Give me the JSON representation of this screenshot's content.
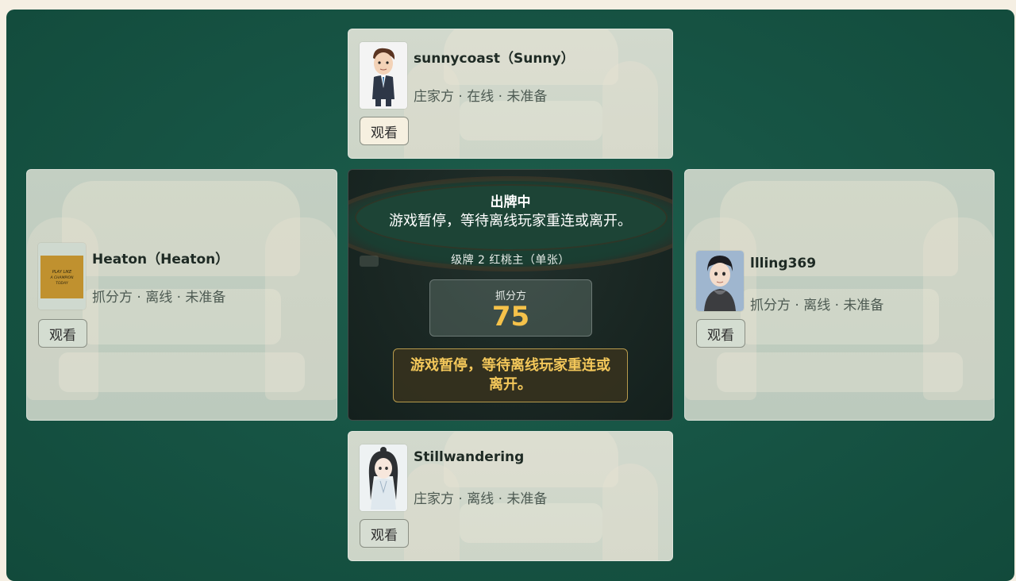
{
  "seats": {
    "top": {
      "name": "sunnycoast（Sunny）",
      "status": "庄家方 · 在线 · 未准备",
      "watch_label": "观看"
    },
    "left": {
      "name": "Heaton（Heaton）",
      "status": "抓分方 · 离线 · 未准备",
      "watch_label": "观看",
      "avatar_text": "PLAY LIKE A CHAMPION TODAY"
    },
    "right": {
      "name": "llling369",
      "status": "抓分方 · 离线 · 未准备",
      "watch_label": "观看"
    },
    "bottom": {
      "name": "Stillwandering",
      "status": "庄家方 · 离线 · 未准备",
      "watch_label": "观看"
    }
  },
  "table": {
    "phase": "出牌中",
    "message": "游戏暂停，等待离线玩家重连或离开。",
    "level_info": "级牌 2  红桃主（单张）",
    "score_label": "抓分方",
    "score_value": "75",
    "banner": "游戏暂停，等待离线玩家重连或离开。"
  },
  "colors": {
    "felt": "#175545",
    "score": "#f5c24a",
    "banner_text": "#f3c75a"
  },
  "icons": {
    "top_avatar": "businessman-avatar",
    "left_avatar": "champion-sign-avatar",
    "right_avatar": "boy-avatar",
    "bottom_avatar": "anime-character-avatar"
  }
}
